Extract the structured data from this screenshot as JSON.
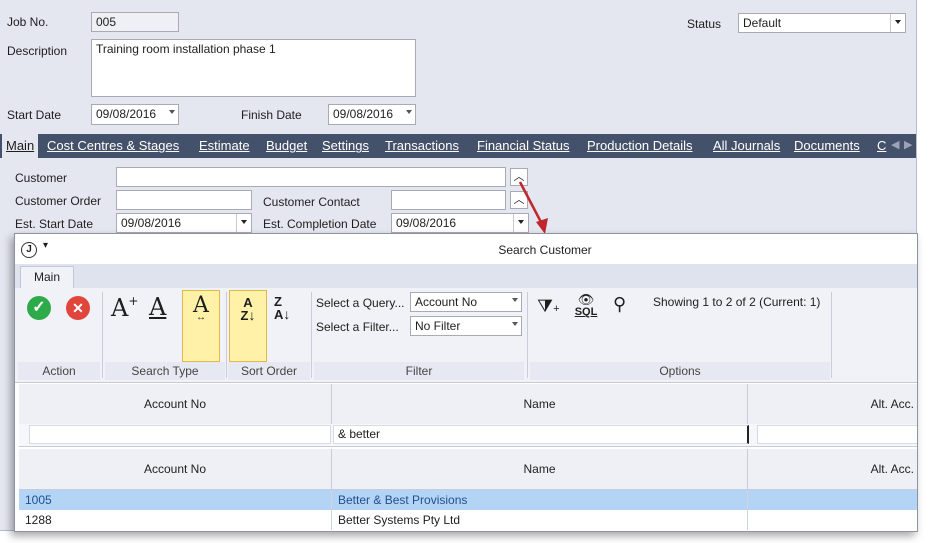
{
  "form": {
    "job_no_label": "Job No.",
    "job_no": "005",
    "description_label": "Description",
    "description": "Training room installation phase 1",
    "start_date_label": "Start Date",
    "start_date": "09/08/2016",
    "finish_date_label": "Finish Date",
    "finish_date": "09/08/2016",
    "status_label": "Status",
    "status": "Default"
  },
  "tabs": [
    "Main",
    "Cost Centres & Stages",
    "Estimate",
    "Budget",
    "Settings",
    "Transactions",
    "Financial Status",
    "Production Details",
    "All Journals",
    "Documents",
    "C"
  ],
  "main_tab": {
    "customer_label": "Customer",
    "customer_order_label": "Customer Order",
    "customer_contact_label": "Customer Contact",
    "est_start_label": "Est. Start Date",
    "est_start": "09/08/2016",
    "est_completion_label": "Est. Completion Date",
    "est_completion": "09/08/2016"
  },
  "dialog": {
    "title": "Search Customer",
    "ribbon_tab": "Main",
    "groups": {
      "action": "Action",
      "search_type": "Search Type",
      "sort_order": "Sort Order",
      "filter": "Filter",
      "options": "Options"
    },
    "select_query_label": "Select a Query...",
    "select_query": "Account No",
    "select_filter_label": "Select a Filter...",
    "select_filter": "No Filter",
    "sql_label": "SQL",
    "showing": "Showing 1 to 2 of 2 (Current: 1)",
    "columns": [
      "Account No",
      "Name",
      "Alt. Acc."
    ],
    "search_name_value": "& better",
    "results": [
      {
        "account_no": "1005",
        "name": "Better & Best Provisions",
        "selected": true
      },
      {
        "account_no": "1288",
        "name": "Better Systems Pty Ltd",
        "selected": false
      }
    ]
  },
  "colors": {
    "tabbar": "#44516a",
    "selected_row": "#b3d4f5",
    "highlight_button": "#fff2a8",
    "accept_green": "#2daa4a",
    "cancel_red": "#e0463c",
    "pointer_arrow": "#c0272d"
  }
}
